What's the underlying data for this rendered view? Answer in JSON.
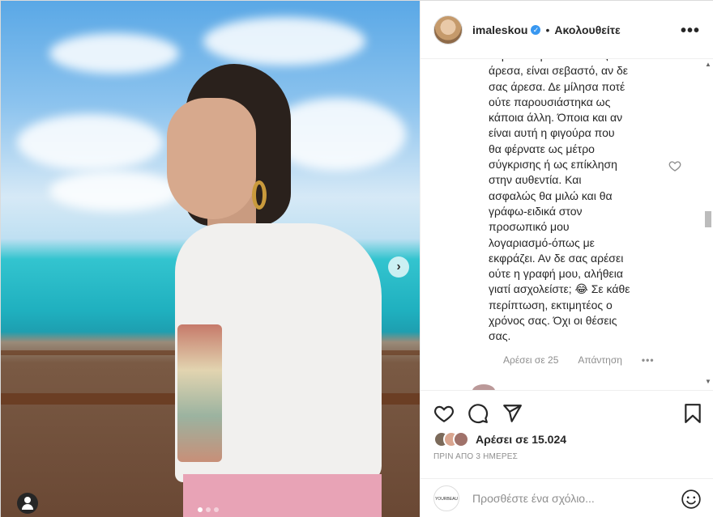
{
  "post": {
    "username": "imaleskou",
    "separator": "•",
    "follow_state": "Ακολουθείτε",
    "more_label": "•••",
    "caption_lines": [
      "περισσότερο και αν σας",
      "άρεσα, είναι σεβαστό, αν δε",
      "σας άρεσα. Δε μίλησα ποτέ",
      "ούτε παρουσιάστηκα ως",
      "κάποια άλλη. Όποια και αν",
      "είναι αυτή η φιγούρα που",
      "θα φέρνατε ως μέτρο",
      "σύγκρισης ή ως επίκληση",
      "στην αυθεντία. Και",
      "ασφαλώς θα μιλώ και θα",
      "γράφω-ειδικά στον",
      "προσωπικό μου",
      "λογαριασμό-όπως με",
      "εκφράζει. Αν δε σας αρέσει",
      "ούτε η γραφή μου, αλήθεια",
      "γιατί ασχολείστε; 😂 Σε κάθε",
      "περίπτωση, εκτιμητέος ο",
      "χρόνος σας. Όχι οι θέσεις",
      "σας."
    ],
    "comment_likes": "Αρέσει σε 25",
    "reply_label": "Απάντηση",
    "comment_more": "•••",
    "likes_text": "Αρέσει σε 15.024",
    "time_ago": "ΠΡΙΝ ΑΠΟ 3 ΗΜΕΡΕΣ",
    "comment_placeholder": "Προσθέστε ένα σχόλιο...",
    "self_avatar_text": "YOURBEAU",
    "carousel": {
      "count": 3,
      "active": 0
    }
  },
  "icons": {
    "verified": "verified-badge-icon",
    "like": "heart-icon",
    "comment": "comment-bubble-icon",
    "share": "paper-plane-icon",
    "save": "bookmark-icon",
    "emoji": "smiley-icon",
    "next": "chevron-right-icon"
  },
  "colors": {
    "verified": "#3897f0",
    "muted": "#8e8e8e",
    "text": "#262626"
  }
}
